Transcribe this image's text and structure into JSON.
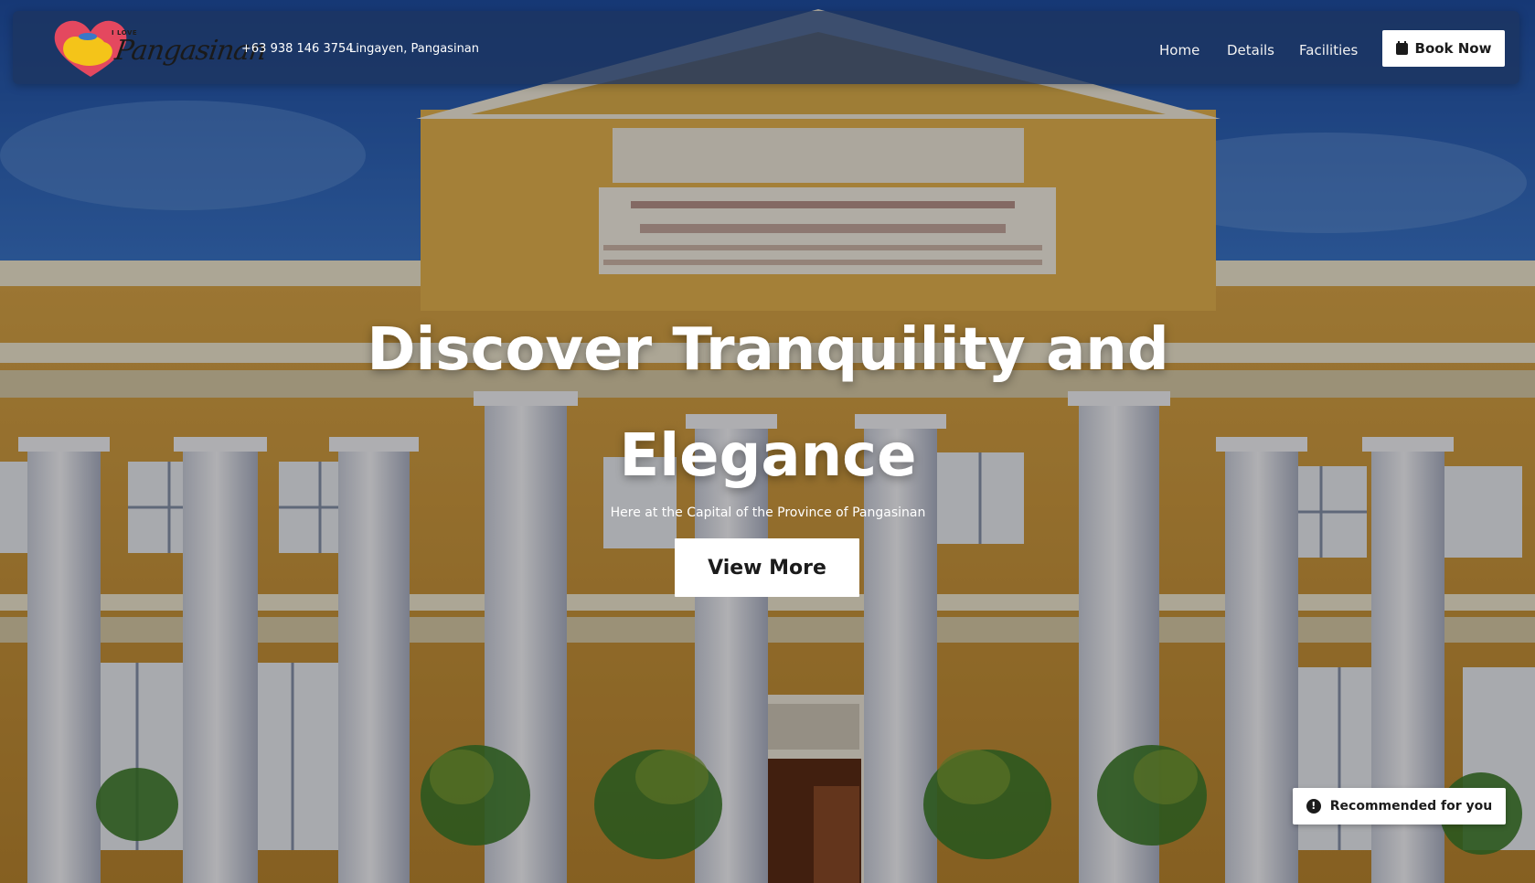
{
  "navbar": {
    "logo_alt": "I Love Pangasinan",
    "logo_small_text": "I LOVE",
    "logo_script_text": "Pangasinan",
    "phone": "+63 938 146 3754",
    "location": "Lingayen, Pangasinan",
    "links": [
      {
        "label": "Home"
      },
      {
        "label": "Details"
      },
      {
        "label": "Facilities"
      }
    ],
    "cta_label": "Book Now",
    "cta_icon": "calendar-icon"
  },
  "hero": {
    "title": "Discover Tranquility and Elegance",
    "subtitle": "Here at the Capital of the Province of Pangasinan",
    "button_label": "View More",
    "background_image": "Pangasinan Provincial Capitol Building facade"
  },
  "badge": {
    "label": "Recommended for you",
    "icon": "alert-circle-icon"
  },
  "colors": {
    "navbar_bg": "#1c3460",
    "button_bg": "#ffffff",
    "text_dark": "#1b1b1b",
    "text_light": "#ffffff"
  }
}
